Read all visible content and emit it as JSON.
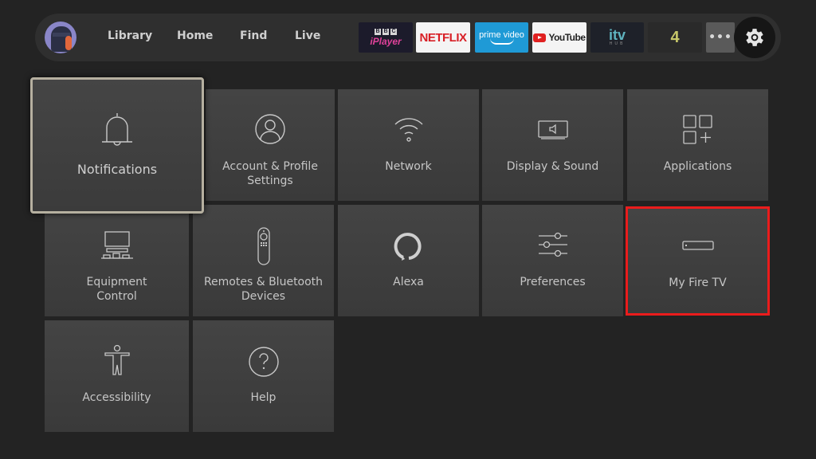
{
  "topbar": {
    "profile": {
      "icon": "profile-avatar"
    },
    "nav": [
      {
        "label": "Library"
      },
      {
        "label": "Home"
      },
      {
        "label": "Find"
      },
      {
        "label": "Live"
      }
    ],
    "apps": {
      "bbc": {
        "top": [
          "B",
          "B",
          "C"
        ],
        "bottom": "iPlayer"
      },
      "netflix": {
        "label": "NETFLIX"
      },
      "prime": {
        "label": "prime video"
      },
      "youtube": {
        "label": "YouTube"
      },
      "itv": {
        "label": "itv",
        "sub": "HUB"
      },
      "channel4": {
        "label": "4"
      },
      "more": {
        "label": "•••"
      }
    },
    "settings": {
      "icon": "gear-icon"
    }
  },
  "tiles": [
    {
      "label": "Notifications",
      "icon": "bell-icon",
      "state": "focused"
    },
    {
      "label": "Account & Profile\nSettings",
      "line1": "Account & Profile",
      "line2": "Settings",
      "icon": "user-circle-icon"
    },
    {
      "label": "Network",
      "icon": "wifi-icon"
    },
    {
      "label": "Display & Sound",
      "icon": "tv-sound-icon"
    },
    {
      "label": "Applications",
      "icon": "apps-grid-icon"
    },
    {
      "line1": "Equipment",
      "line2": "Control",
      "icon": "equipment-icon"
    },
    {
      "line1": "Remotes & Bluetooth",
      "line2": "Devices",
      "icon": "remote-icon"
    },
    {
      "label": "Alexa",
      "icon": "alexa-ring-icon"
    },
    {
      "label": "Preferences",
      "icon": "sliders-icon"
    },
    {
      "label": "My Fire TV",
      "icon": "fire-stick-icon",
      "state": "highlighted"
    },
    {
      "label": "Accessibility",
      "icon": "accessibility-icon"
    },
    {
      "label": "Help",
      "icon": "help-circle-icon"
    }
  ],
  "colors": {
    "highlight_border": "#ea1c1c",
    "focus_border": "#b6b0a0",
    "background": "#232323",
    "tile": "#404040"
  }
}
